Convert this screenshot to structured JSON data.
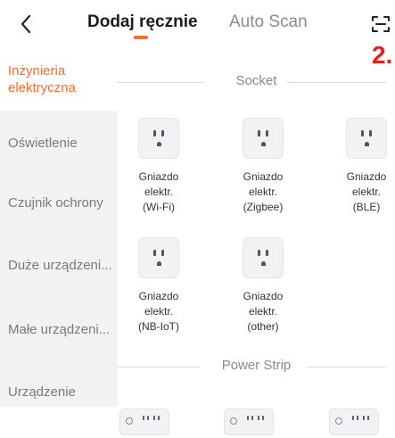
{
  "header": {
    "tab_manual": "Dodaj ręcznie",
    "tab_auto": "Auto Scan",
    "annotation": "2."
  },
  "colors": {
    "accent": "#ff6a2b",
    "annotation": "#e02020"
  },
  "icons": {
    "back": "chevron-left-icon",
    "scan": "scan-icon"
  },
  "sidebar": {
    "items": [
      {
        "label": "Inżynieria elektryczna",
        "active": true
      },
      {
        "label": "Oświetlenie"
      },
      {
        "label": "Czujnik ochrony"
      },
      {
        "label": "Duże urządzeni..."
      },
      {
        "label": "Małe urządzeni..."
      },
      {
        "label": "Urządzenie"
      }
    ]
  },
  "sections": [
    {
      "title": "Socket",
      "devices": [
        {
          "lines": [
            "Gniazdo",
            "elektr.",
            "(Wi-Fi)"
          ]
        },
        {
          "lines": [
            "Gniazdo",
            "elektr.",
            "(Zigbee)"
          ]
        },
        {
          "lines": [
            "Gniazdo",
            "elektr.",
            "(BLE)"
          ]
        },
        {
          "lines": [
            "Gniazdo",
            "elektr.",
            "(NB-IoT)"
          ]
        },
        {
          "lines": [
            "Gniazdo",
            "elektr.",
            "(other)"
          ]
        }
      ]
    },
    {
      "title": "Power Strip"
    }
  ]
}
